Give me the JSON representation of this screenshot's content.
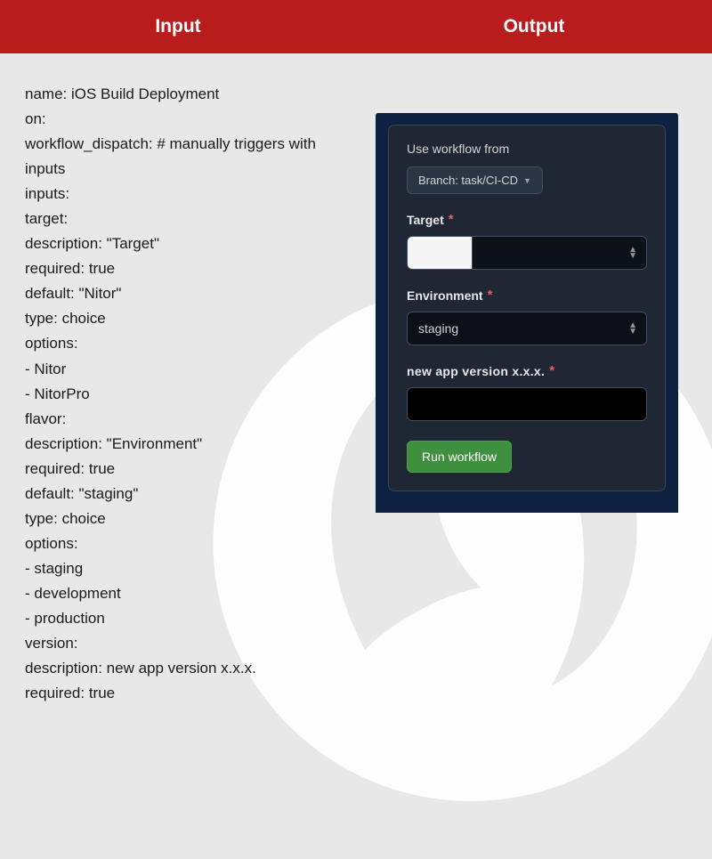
{
  "header": {
    "input_label": "Input",
    "output_label": "Output"
  },
  "yaml": {
    "lines": [
      "name: iOS Build Deployment",
      "on:",
      "workflow_dispatch: # manually triggers with inputs",
      "inputs:",
      "target:",
      "description: \"Target\"",
      "required: true",
      "default: \"Nitor\"",
      "type: choice",
      "options:",
      "- Nitor",
      "- NitorPro",
      "flavor:",
      "description: \"Environment\"",
      "required: true",
      "default: \"staging\"",
      "type: choice",
      "options:",
      "- staging",
      "- development",
      "- production",
      "version:",
      "description: new app version x.x.x.",
      "required: true"
    ]
  },
  "dialog": {
    "use_workflow_from": "Use workflow from",
    "branch_label": "Branch: task/CI-CD",
    "target": {
      "label": "Target",
      "options": [
        "Nitor",
        "NitorPro"
      ],
      "value": ""
    },
    "environment": {
      "label": "Environment",
      "options": [
        "staging",
        "development",
        "production"
      ],
      "value": "staging"
    },
    "version": {
      "label": "new app version x.x.x.",
      "value": ""
    },
    "run_button": "Run workflow"
  }
}
